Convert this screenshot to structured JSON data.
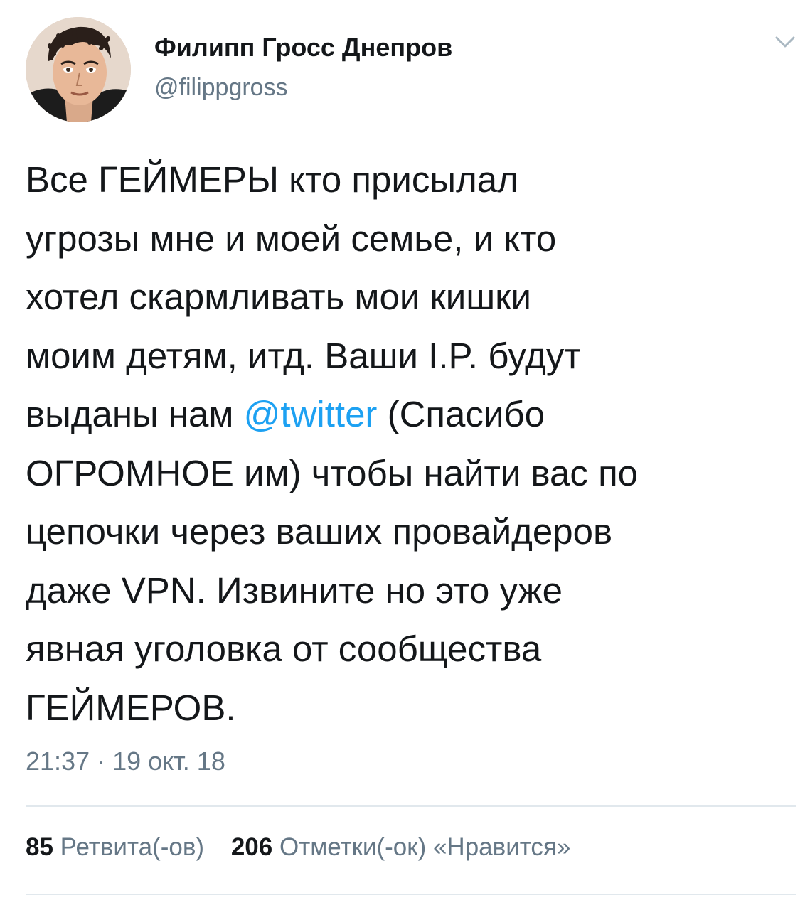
{
  "author": {
    "name": "Филипп Гросс Днепров",
    "handle": "@filippgross"
  },
  "tweet": {
    "text_before": "Все ГЕЙМЕРЫ кто присылал\nугрозы мне и моей семье, и кто\nхотел скармливать мои кишки\nмоим детям, итд. Ваши I.P. будут\nвыданы нам ",
    "mention": "@twitter",
    "text_after": " (Спасибо\nОГРОМНОЕ им) чтобы найти вас по\nцепочки через ваших провайдеров\nдаже VPN. Извините но это уже\nявная уголовка от сообщества\nГЕЙМЕРОВ.",
    "timestamp": "21:37 · 19 окт. 18"
  },
  "stats": {
    "retweets_count": "85",
    "retweets_label": "Ретвита(-ов)",
    "likes_count": "206",
    "likes_label": "Отметки(-ок) «Нравится»"
  },
  "icons": {
    "avatar": "user-avatar",
    "chevron": "chevron-down-icon"
  },
  "colors": {
    "link": "#1da1f2",
    "secondary_text": "#657786",
    "primary_text": "#14171a",
    "divider": "#e1e8ed"
  }
}
